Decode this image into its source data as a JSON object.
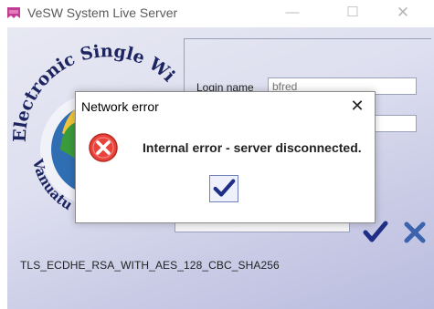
{
  "window": {
    "title": "VeSW System Live Server",
    "minimize_glyph": "—",
    "maximize_glyph": "☐",
    "close_glyph": "✕"
  },
  "logo": {
    "top_text": "Electronic Single Wi",
    "bottom_text": "Vanuatu"
  },
  "login": {
    "login_name_label": "Login name",
    "login_name_value": "bfred",
    "password_value": "",
    "server_value": ""
  },
  "buttons": {
    "ok_icon": "checkmark-icon",
    "cancel_icon": "x-icon"
  },
  "status": {
    "tls_text": "TLS_ECDHE_RSA_WITH_AES_128_CBC_SHA256"
  },
  "dialog": {
    "title": "Network error",
    "close_glyph": "✕",
    "message": "Internal error - server disconnected.",
    "icon": "error-icon",
    "ok_icon": "checkmark-icon"
  },
  "colors": {
    "error_red": "#e8423a",
    "check_blue": "#1f2f86",
    "cancel_blue": "#3c63ad",
    "background_lavender": "#c9cbe6"
  }
}
